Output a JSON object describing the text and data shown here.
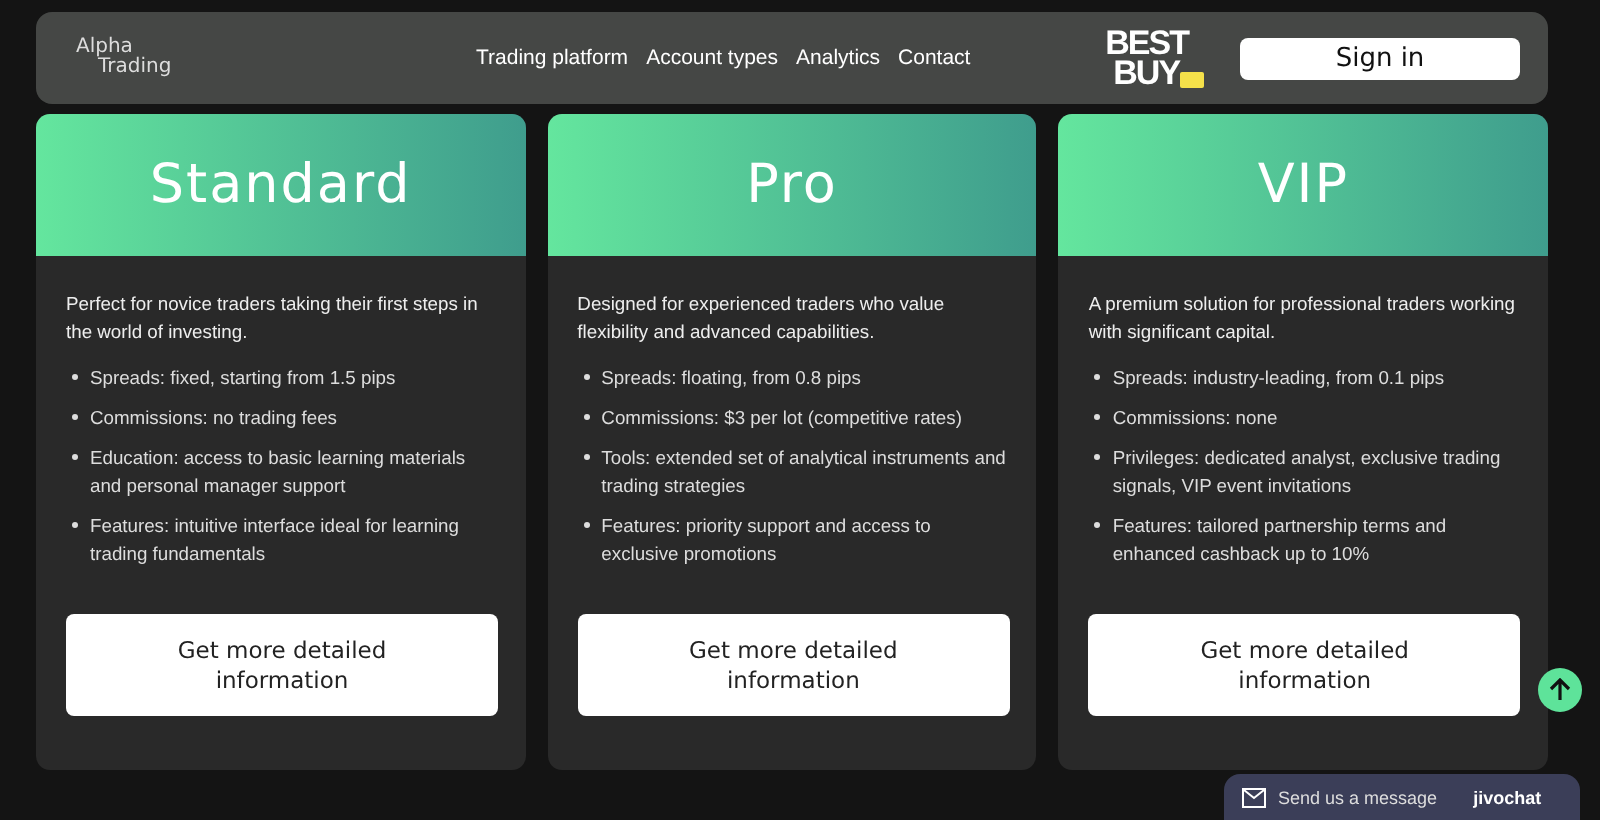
{
  "header": {
    "logo": [
      "Alpha",
      "Trading"
    ],
    "nav": [
      {
        "label": "Trading platform"
      },
      {
        "label": "Account types"
      },
      {
        "label": "Analytics"
      },
      {
        "label": "Contact"
      }
    ],
    "partner_logo": [
      "BEST",
      "BUY"
    ],
    "sign_in": "Sign in"
  },
  "plans": [
    {
      "title": "Standard",
      "description": "Perfect for novice traders taking their first steps in the world of investing.",
      "features": [
        "Spreads: fixed, starting from 1.5 pips",
        "Commissions: no trading fees",
        "Education: access to basic learning materials and personal manager support",
        "Features: intuitive interface ideal for learning trading fundamentals"
      ],
      "button": "Get more detailed information"
    },
    {
      "title": "Pro",
      "description": "Designed for experienced traders who value flexibility and advanced capabilities.",
      "features": [
        "Spreads: floating, from 0.8 pips",
        "Commissions: $3 per lot (competitive rates)",
        "Tools: extended set of analytical instruments and trading strategies",
        "Features: priority support and access to exclusive promotions"
      ],
      "button": "Get more detailed information"
    },
    {
      "title": "VIP",
      "description": "A premium solution for professional traders working with significant capital.",
      "features": [
        "Spreads: industry-leading, from 0.1 pips",
        "Commissions: none",
        "Privileges: dedicated analyst, exclusive trading signals, VIP event invitations",
        "Features: tailored partnership terms and enhanced cashback up to 10%"
      ],
      "button": "Get more detailed information"
    }
  ],
  "chat_widget": {
    "label": "Send us a message",
    "brand": "jivochat"
  }
}
